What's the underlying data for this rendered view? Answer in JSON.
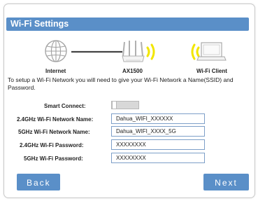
{
  "header": {
    "title": "Wi-Fi Settings"
  },
  "diagram": {
    "internet_label": "Internet",
    "router_label": "AX1500",
    "client_label": "Wi-Fi Client",
    "icons": [
      "globe-icon",
      "router-icon",
      "wifi-signal-icon",
      "laptop-icon"
    ]
  },
  "description": "To setup a Wi-Fi Network you will need to give your Wi-Fi Network a Name(SSID) and Password.",
  "form": {
    "smart_connect_label": "Smart Connect:",
    "smart_connect_enabled": false,
    "ssid_24_label": "2.4GHz Wi-Fi Network Name:",
    "ssid_24_value": "Dahua_WIFI_XXXXXX",
    "ssid_5_label": "5GHz Wi-Fi Network Name:",
    "ssid_5_value": "Dahua_WIFI_XXXX_5G",
    "pwd_24_label": "2.4GHz Wi-Fi Password:",
    "pwd_24_value": "XXXXXXXX",
    "pwd_5_label": "5GHz Wi-Fi Password:",
    "pwd_5_value": "XXXXXXXX"
  },
  "buttons": {
    "back": "Back",
    "next": "Next"
  },
  "colors": {
    "accent": "#5a8fc8",
    "signal": "#f2e600",
    "field_border": "#7d9fc8"
  }
}
